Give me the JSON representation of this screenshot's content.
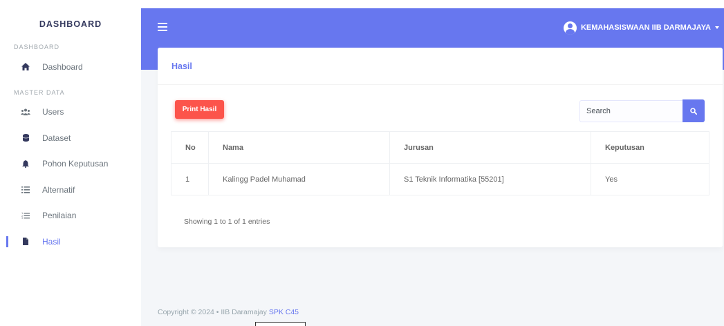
{
  "sidebar": {
    "brand": "DASHBOARD",
    "header_dashboard": "DASHBOARD",
    "header_master": "MASTER DATA",
    "items": [
      {
        "label": "Dashboard",
        "icon": "home-icon"
      },
      {
        "label": "Users",
        "icon": "users-icon"
      },
      {
        "label": "Dataset",
        "icon": "database-icon"
      },
      {
        "label": "Pohon Keputusan",
        "icon": "bell-icon"
      },
      {
        "label": "Alternatif",
        "icon": "list-icon"
      },
      {
        "label": "Penilaian",
        "icon": "ordered-list-icon"
      },
      {
        "label": "Hasil",
        "icon": "file-icon",
        "active": true
      }
    ]
  },
  "navbar": {
    "user_name": "KEMAHASISWAAN IIB DARMAJAYA"
  },
  "card": {
    "title": "Hasil",
    "print_label": "Print Hasil",
    "search_placeholder": "Search",
    "table": {
      "headers": [
        "No",
        "Nama",
        "Jurusan",
        "Keputusan"
      ],
      "rows": [
        [
          "1",
          "Kalingg Padel Muhamad",
          "S1 Teknik Informatika [55201]",
          "Yes"
        ]
      ]
    },
    "info": "Showing 1 to 1 of 1 entries"
  },
  "footer": {
    "text": "Copyright © 2024  •  IIB Daramajay ",
    "link": "SPK C45"
  },
  "colors": {
    "primary": "#6777ef",
    "danger": "#fc544b"
  }
}
